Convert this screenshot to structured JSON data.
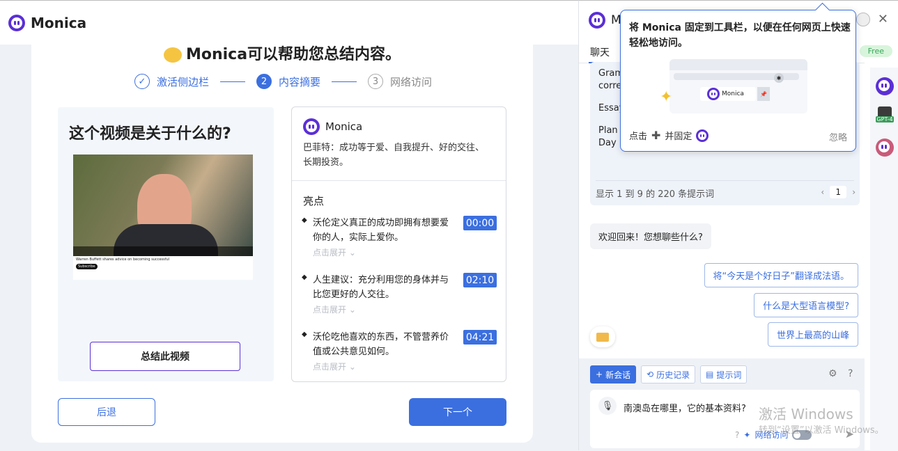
{
  "app": {
    "name": "Monica"
  },
  "onboarding": {
    "title": "Monica可以帮助您总结内容。",
    "steps": [
      {
        "num": "✓",
        "label": "激活侧边栏"
      },
      {
        "num": "2",
        "label": "内容摘要"
      },
      {
        "num": "3",
        "label": "网络访问"
      }
    ],
    "question": "这个视频是关于什么的?",
    "video": {
      "caption": "Warren Buffett shares advice on becoming successful",
      "subscribe": "Subscribe"
    },
    "summarize_button": "总结此视频",
    "summary": {
      "brand": "Monica",
      "description": "巴菲特：成功等于爱、自我提升、好的交往、长期投资。",
      "highlights_label": "亮点",
      "items": [
        {
          "text": "沃伦定义真正的成功即拥有想要爱你的人，实际上爱你。",
          "time": "00:00",
          "more": "点击展开 ⌄"
        },
        {
          "text": "人生建议：充分利用您的身体并与比您更好的人交往。",
          "time": "02:10",
          "more": "点击展开 ⌄"
        },
        {
          "text": "沃伦吃他喜欢的东西，不管营养价值或公共意见如何。",
          "time": "04:21",
          "more": "点击展开 ⌄"
        }
      ]
    },
    "back_button": "后退",
    "next_button": "下一个"
  },
  "sidebar": {
    "title": "M",
    "tab_chat": "聊天",
    "badge_free": "Free",
    "prompts": [
      "Gram",
      "corre",
      "Essay",
      "Plan",
      "Day"
    ],
    "prompt_footer": "显示 1 到 9 的 220 条提示词",
    "pager_page": "1",
    "welcome": "欢迎回来！您想聊些什么?",
    "suggestions": [
      "将“今天是个好日子”翻译成法语。",
      "什么是大型语言模型?",
      "世界上最高的山峰"
    ],
    "toolbar": {
      "new_chat": "新会话",
      "history": "历史记录",
      "prompts": "提示词"
    },
    "input_text": "南澳岛在哪里，它的基本资料?",
    "web_access": "网络访问",
    "rail": {
      "gpt4": "GPT-4"
    }
  },
  "popover": {
    "title": "将 Monica 固定到工具栏，以便在任何网页上快速轻松地访问。",
    "illustration_chip": "Monica",
    "footer_click": "点击",
    "footer_pin": "并固定",
    "ignore": "忽略"
  },
  "watermark": {
    "line1": "激活 Windows",
    "line2": "转到“设置”以激活 Windows。"
  }
}
